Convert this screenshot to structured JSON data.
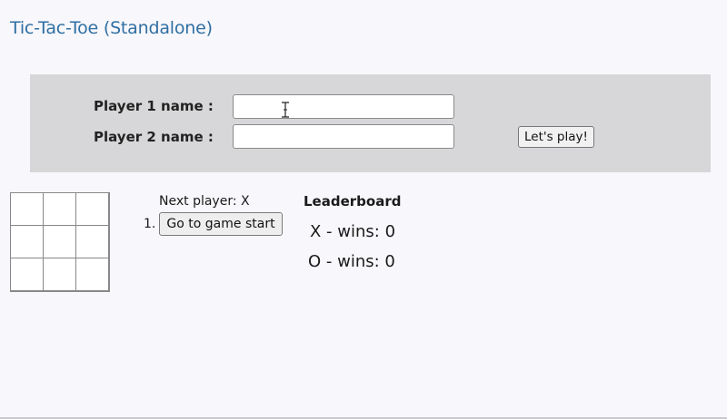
{
  "app": {
    "title": "Tic-Tac-Toe (Standalone)"
  },
  "form": {
    "player1_label": "Player 1 name :",
    "player2_label": "Player 2 name :",
    "player1_value": "",
    "player2_value": "",
    "play_button_label": "Let's play!"
  },
  "board": {
    "cells": [
      "",
      "",
      "",
      "",
      "",
      "",
      "",
      "",
      ""
    ]
  },
  "status": {
    "next_player": "Next player: X"
  },
  "history": {
    "items": [
      {
        "number": "1.",
        "label": "Go to game start"
      }
    ]
  },
  "leaderboard": {
    "title": "Leaderboard",
    "x_wins": "X - wins: 0",
    "o_wins": "O - wins: 0"
  },
  "colors": {
    "title": "#2f6fa3",
    "panel": "#d7d6d8",
    "background": "#f8f7fb"
  },
  "icons": {
    "cursor": "text-cursor-icon"
  }
}
